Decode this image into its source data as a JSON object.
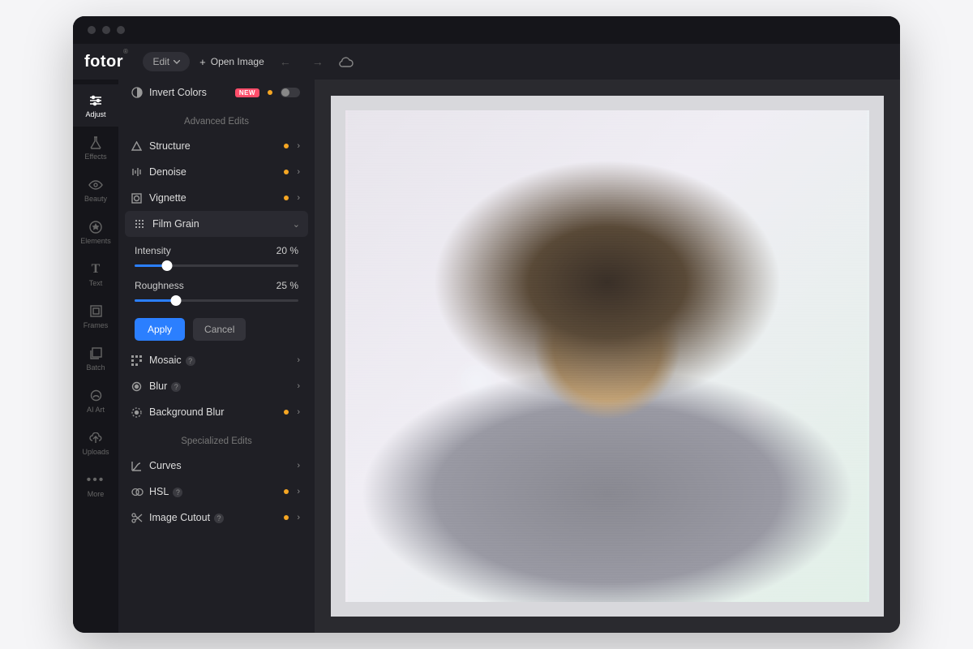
{
  "app": {
    "logo": "fotor"
  },
  "toolbar": {
    "edit_label": "Edit",
    "open_image_label": "Open Image"
  },
  "sidebar": {
    "items": [
      {
        "label": "Adjust"
      },
      {
        "label": "Effects"
      },
      {
        "label": "Beauty"
      },
      {
        "label": "Elements"
      },
      {
        "label": "Text"
      },
      {
        "label": "Frames"
      },
      {
        "label": "Batch"
      },
      {
        "label": "AI Art"
      },
      {
        "label": "Uploads"
      },
      {
        "label": "More"
      }
    ]
  },
  "panel": {
    "invert_colors": {
      "label": "Invert Colors",
      "badge": "NEW"
    },
    "headings": {
      "advanced": "Advanced Edits",
      "specialized": "Specialized Edits"
    },
    "rows": {
      "structure": "Structure",
      "denoise": "Denoise",
      "vignette": "Vignette",
      "film_grain": "Film Grain",
      "mosaic": "Mosaic",
      "blur": "Blur",
      "bg_blur": "Background Blur",
      "curves": "Curves",
      "hsl": "HSL",
      "image_cutout": "Image Cutout"
    },
    "sliders": {
      "intensity": {
        "label": "Intensity",
        "value": "20 %",
        "percent": 20
      },
      "roughness": {
        "label": "Roughness",
        "value": "25 %",
        "percent": 25
      }
    },
    "buttons": {
      "apply": "Apply",
      "cancel": "Cancel"
    }
  }
}
